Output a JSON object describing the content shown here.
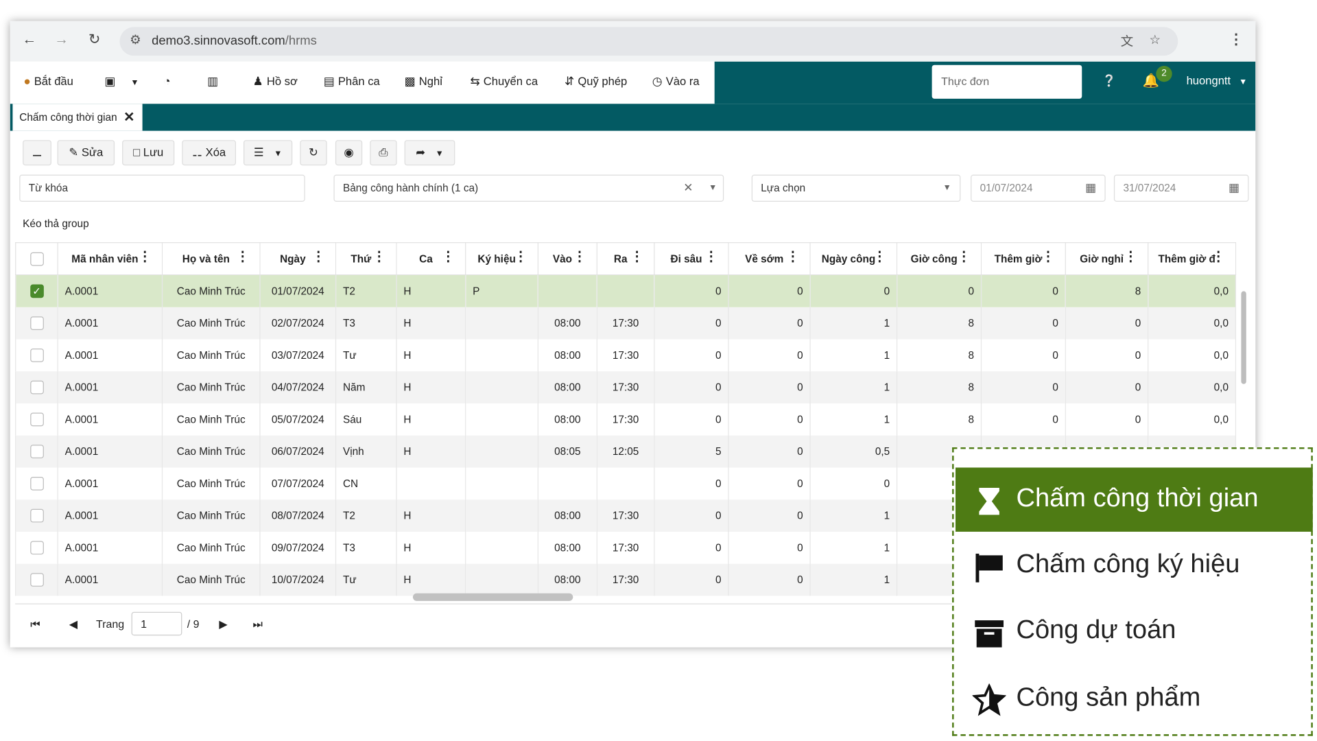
{
  "browser": {
    "url_host": "demo3.sinnovasoft.com",
    "url_path": "/hrms"
  },
  "menu": {
    "items": [
      {
        "label": "Bắt đầu",
        "icon": "coins-icon"
      },
      {
        "label": "",
        "icon": "cube-icon"
      },
      {
        "label": "",
        "icon": "dashboard-icon"
      },
      {
        "label": "",
        "icon": "bar-chart-icon"
      },
      {
        "label": "Hồ sơ",
        "icon": "user-icon"
      },
      {
        "label": "Phân ca",
        "icon": "list-icon"
      },
      {
        "label": "Nghỉ",
        "icon": "id-card-icon"
      },
      {
        "label": "Chuyển ca",
        "icon": "swap-icon"
      },
      {
        "label": "Quỹ phép",
        "icon": "exchange-icon"
      },
      {
        "label": "Vào ra",
        "icon": "clock-icon"
      }
    ],
    "search_placeholder": "Thực đơn",
    "notification_count": "2",
    "user": "huongntt"
  },
  "tab": {
    "label": "Chấm công thời gian"
  },
  "toolbar": {
    "edit": "Sửa",
    "save": "Lưu",
    "delete": "Xóa"
  },
  "filters": {
    "keyword_placeholder": "Từ khóa",
    "timesheet": "Bảng công hành chính (1 ca)",
    "choice": "Lựa chọn",
    "from_date": "01/07/2024",
    "to_date": "31/07/2024"
  },
  "group_hint": "Kéo thả group",
  "table": {
    "columns": [
      "Mã nhân viên",
      "Họ và tên",
      "Ngày",
      "Thứ",
      "Ca",
      "Ký hiệu",
      "Vào",
      "Ra",
      "Đi sâu",
      "Về sớm",
      "Ngày công",
      "Giờ công",
      "Thêm giờ",
      "Giờ nghỉ",
      "Thêm giờ đ"
    ],
    "rows": [
      {
        "checked": true,
        "cells": [
          "A.0001",
          "Cao Minh Trúc",
          "01/07/2024",
          "T2",
          "H",
          "P",
          "",
          "",
          "0",
          "0",
          "0",
          "0",
          "0",
          "8",
          "0,0"
        ]
      },
      {
        "checked": false,
        "cells": [
          "A.0001",
          "Cao Minh Trúc",
          "02/07/2024",
          "T3",
          "H",
          "",
          "08:00",
          "17:30",
          "0",
          "0",
          "1",
          "8",
          "0",
          "0",
          "0,0"
        ]
      },
      {
        "checked": false,
        "cells": [
          "A.0001",
          "Cao Minh Trúc",
          "03/07/2024",
          "Tư",
          "H",
          "",
          "08:00",
          "17:30",
          "0",
          "0",
          "1",
          "8",
          "0",
          "0",
          "0,0"
        ]
      },
      {
        "checked": false,
        "cells": [
          "A.0001",
          "Cao Minh Trúc",
          "04/07/2024",
          "Năm",
          "H",
          "",
          "08:00",
          "17:30",
          "0",
          "0",
          "1",
          "8",
          "0",
          "0",
          "0,0"
        ]
      },
      {
        "checked": false,
        "cells": [
          "A.0001",
          "Cao Minh Trúc",
          "05/07/2024",
          "Sáu",
          "H",
          "",
          "08:00",
          "17:30",
          "0",
          "0",
          "1",
          "8",
          "0",
          "0",
          "0,0"
        ]
      },
      {
        "checked": false,
        "cells": [
          "A.0001",
          "Cao Minh Trúc",
          "06/07/2024",
          "Vịnh",
          "H",
          "",
          "08:05",
          "12:05",
          "5",
          "0",
          "0,5",
          "",
          "",
          "",
          ""
        ]
      },
      {
        "checked": false,
        "cells": [
          "A.0001",
          "Cao Minh Trúc",
          "07/07/2024",
          "CN",
          "",
          "",
          "",
          "",
          "0",
          "0",
          "0",
          "",
          "",
          "",
          ""
        ]
      },
      {
        "checked": false,
        "cells": [
          "A.0001",
          "Cao Minh Trúc",
          "08/07/2024",
          "T2",
          "H",
          "",
          "08:00",
          "17:30",
          "0",
          "0",
          "1",
          "",
          "",
          "",
          ""
        ]
      },
      {
        "checked": false,
        "cells": [
          "A.0001",
          "Cao Minh Trúc",
          "09/07/2024",
          "T3",
          "H",
          "",
          "08:00",
          "17:30",
          "0",
          "0",
          "1",
          "",
          "",
          "",
          ""
        ]
      },
      {
        "checked": false,
        "cells": [
          "A.0001",
          "Cao Minh Trúc",
          "10/07/2024",
          "Tư",
          "H",
          "",
          "08:00",
          "17:30",
          "0",
          "0",
          "1",
          "",
          "",
          "",
          ""
        ]
      }
    ]
  },
  "pager": {
    "label": "Trang",
    "page": "1",
    "total": "/ 9"
  },
  "popup": {
    "items": [
      {
        "label": "Chấm công thời gian",
        "icon": "hourglass-icon",
        "active": true
      },
      {
        "label": "Chấm công ký hiệu",
        "icon": "flag-icon",
        "active": false
      },
      {
        "label": "Công dự toán",
        "icon": "archive-icon",
        "active": false
      },
      {
        "label": "Công sản phẩm",
        "icon": "star-icon",
        "active": false
      }
    ]
  },
  "colors": {
    "teal": "#035a63",
    "green": "#4e7b14",
    "selected_row": "#d9e8c9"
  }
}
